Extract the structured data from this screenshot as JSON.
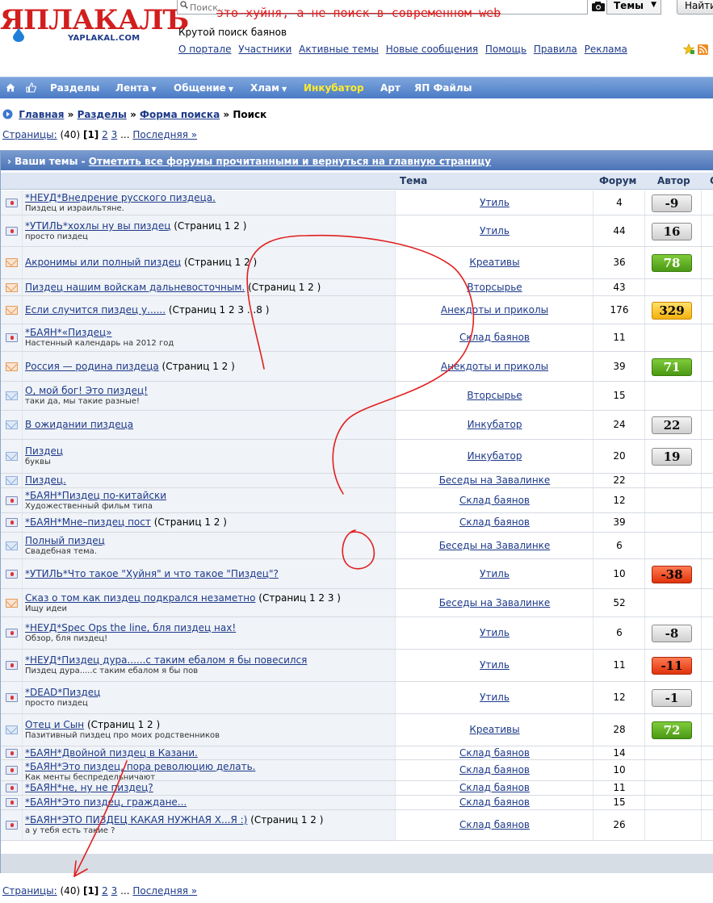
{
  "colors": {
    "nav_bg": "#4a7bc6",
    "nav_highlight": "#ffec2a",
    "link": "#1d3a8a",
    "logo_red": "#d21e1e",
    "annotation_red": "#e02020"
  },
  "header": {
    "logo_text": "ЯПЛАКАЛЪ",
    "logo_domain": "YAPLAKAL.COM",
    "search_placeholder": "Поиск...",
    "themes_label": "Темы",
    "find_label": "Найти",
    "slogan": "Крутой поиск баянов",
    "links": [
      "О портале",
      "Участники",
      "Активные темы",
      "Новые сообщения",
      "Помощь",
      "Правила",
      "Реклама"
    ]
  },
  "annotation": {
    "caption": "это хуйня, а не поиск в современном web"
  },
  "nav": {
    "items": [
      "Разделы",
      "Лента",
      "Общение",
      "Хлам",
      "Инкубатор",
      "Арт",
      "ЯП Файлы"
    ]
  },
  "breadcrumb": {
    "items": [
      "Главная",
      "Разделы",
      "Форма поиска"
    ],
    "current": "Поиск",
    "sep": "»"
  },
  "pagination": {
    "label": "Страницы:",
    "total": "(40)",
    "current": "[1]",
    "pages": [
      "2",
      "3"
    ],
    "dots": "...",
    "last": "Последняя »"
  },
  "table": {
    "header_prefix": "› Ваши темы -",
    "header_link": "Отметить все форумы прочитанными и вернуться на главную страницу",
    "columns": {
      "topic": "Тема",
      "forum": "Форум",
      "author": "Автор",
      "last": "С"
    },
    "rows": [
      {
        "icon": "pin",
        "title": "*НЕУД*Внедрение русского пиздеца.",
        "pages": "",
        "sub": "Пиздец и израильтяне.",
        "forum": "Утиль",
        "count": "4",
        "rating": "-9",
        "rating_color": "gray"
      },
      {
        "icon": "pin",
        "title": "*УТИЛЬ*хохлы ну вы пиздец",
        "pages": "(Страниц 1 2 )",
        "sub": "просто пиздец",
        "forum": "Утиль",
        "count": "44",
        "rating": "16",
        "rating_color": "gray"
      },
      {
        "icon": "mail-orange",
        "title": "Акронимы или полный пиздец",
        "pages": "(Страниц 1 2 )",
        "sub": "",
        "forum": "Креативы",
        "count": "36",
        "rating": "78",
        "rating_color": "green"
      },
      {
        "icon": "mail-orange",
        "title": "Пиздец нашим войскам дальневосточным.",
        "pages": "(Страниц 1 2 )",
        "sub": "",
        "forum": "Вторсырье",
        "count": "43",
        "rating": "",
        "rating_color": ""
      },
      {
        "icon": "mail-orange",
        "title": "Если случится пиздец у......",
        "pages": "(Страниц 1 2 3 ...8 )",
        "sub": "",
        "forum": "Анекдоты и приколы",
        "count": "176",
        "rating": "329",
        "rating_color": "yellow"
      },
      {
        "icon": "pin",
        "title": "*БАЯН*«Пиздец»",
        "pages": "",
        "sub": "Настенный календарь на 2012 год",
        "forum": "Склад баянов",
        "count": "11",
        "rating": "",
        "rating_color": ""
      },
      {
        "icon": "mail-orange",
        "title": "Россия — родина пиздеца",
        "pages": "(Страниц 1 2 )",
        "sub": "",
        "forum": "Анекдоты и приколы",
        "count": "39",
        "rating": "71",
        "rating_color": "green"
      },
      {
        "icon": "mail-blue",
        "title": "О, мой бог! Это пиздец!",
        "pages": "",
        "sub": "таки да, мы такие разные!",
        "forum": "Вторсырье",
        "count": "15",
        "rating": "",
        "rating_color": ""
      },
      {
        "icon": "mail-blue",
        "title": "В ожидании пиздеца",
        "pages": "",
        "sub": "",
        "forum": "Инкубатор",
        "count": "24",
        "rating": "22",
        "rating_color": "gray"
      },
      {
        "icon": "mail-blue",
        "title": "Пиздец",
        "pages": "",
        "sub": "буквы",
        "forum": "Инкубатор",
        "count": "20",
        "rating": "19",
        "rating_color": "gray"
      },
      {
        "icon": "mail-blue",
        "title": "Пиздец.",
        "pages": "",
        "sub": "",
        "forum": "Беседы на Завалинке",
        "count": "22",
        "rating": "",
        "rating_color": ""
      },
      {
        "icon": "pin",
        "title": "*БАЯН*Пиздец по-китайски",
        "pages": "",
        "sub": "Художественный фильм типа",
        "forum": "Склад баянов",
        "count": "12",
        "rating": "",
        "rating_color": ""
      },
      {
        "icon": "pin",
        "title": "*БАЯН*Мне–пиздец пост",
        "pages": "(Страниц 1 2 )",
        "sub": "",
        "forum": "Склад баянов",
        "count": "39",
        "rating": "",
        "rating_color": ""
      },
      {
        "icon": "mail-blue",
        "title": "Полный пиздец",
        "pages": "",
        "sub": "Свадебная тема.",
        "forum": "Беседы на Завалинке",
        "count": "6",
        "rating": "",
        "rating_color": ""
      },
      {
        "icon": "pin",
        "title": "*УТИЛЬ*Что такое \"Хуйня\" и что такое \"Пиздец\"?",
        "pages": "",
        "sub": "",
        "forum": "Утиль",
        "count": "10",
        "rating": "-38",
        "rating_color": "red"
      },
      {
        "icon": "mail-orange",
        "title": "Сказ о том как пиздец подкрался незаметно",
        "pages": "(Страниц 1 2 3 )",
        "sub": "Ищу идеи",
        "forum": "Беседы на Завалинке",
        "count": "52",
        "rating": "",
        "rating_color": ""
      },
      {
        "icon": "pin",
        "title": "*НЕУД*Spec Ops the line, бля пиздец нах!",
        "pages": "",
        "sub": "Обзор, бля пиздец!",
        "forum": "Утиль",
        "count": "6",
        "rating": "-8",
        "rating_color": "gray"
      },
      {
        "icon": "pin",
        "title": "*НЕУД*Пиздец дура......с таким ебалом я бы повесился",
        "pages": "",
        "sub": "Пиздец дура.....с таким ебалом я бы пов",
        "forum": "Утиль",
        "count": "11",
        "rating": "-11",
        "rating_color": "red"
      },
      {
        "icon": "pin",
        "title": "*DEAD*Пиздец",
        "pages": "",
        "sub": "просто пиздец",
        "forum": "Утиль",
        "count": "12",
        "rating": "-1",
        "rating_color": "gray"
      },
      {
        "icon": "mail-blue",
        "title": "Отец и Сын",
        "pages": "(Страниц 1 2 )",
        "sub": "Пазитивный пиздец про моих родственников",
        "forum": "Креативы",
        "count": "28",
        "rating": "72",
        "rating_color": "green"
      },
      {
        "icon": "pin",
        "title": "*БАЯН*Двойной пиздец в Казани.",
        "pages": "",
        "sub": "",
        "forum": "Склад баянов",
        "count": "14",
        "rating": "",
        "rating_color": ""
      },
      {
        "icon": "pin",
        "title": "*БАЯН*Это пиздец, пора революцию делать.",
        "pages": "",
        "sub": "Как менты беспредельничают",
        "forum": "Склад баянов",
        "count": "10",
        "rating": "",
        "rating_color": ""
      },
      {
        "icon": "pin",
        "title": "*БАЯН*не, ну не пиздец?",
        "pages": "",
        "sub": "",
        "forum": "Склад баянов",
        "count": "11",
        "rating": "",
        "rating_color": ""
      },
      {
        "icon": "pin",
        "title": "*БАЯН*Это пиздец, граждане...",
        "pages": "",
        "sub": "",
        "forum": "Склад баянов",
        "count": "15",
        "rating": "",
        "rating_color": ""
      },
      {
        "icon": "pin",
        "title": "*БАЯН*ЭТО ПИЗДЕЦ КАКАЯ НУЖНАЯ Х...Я :)",
        "pages": "(Страниц 1 2 )",
        "sub": "а у тебя есть такие ?",
        "forum": "Склад баянов",
        "count": "26",
        "rating": "",
        "rating_color": ""
      }
    ]
  }
}
